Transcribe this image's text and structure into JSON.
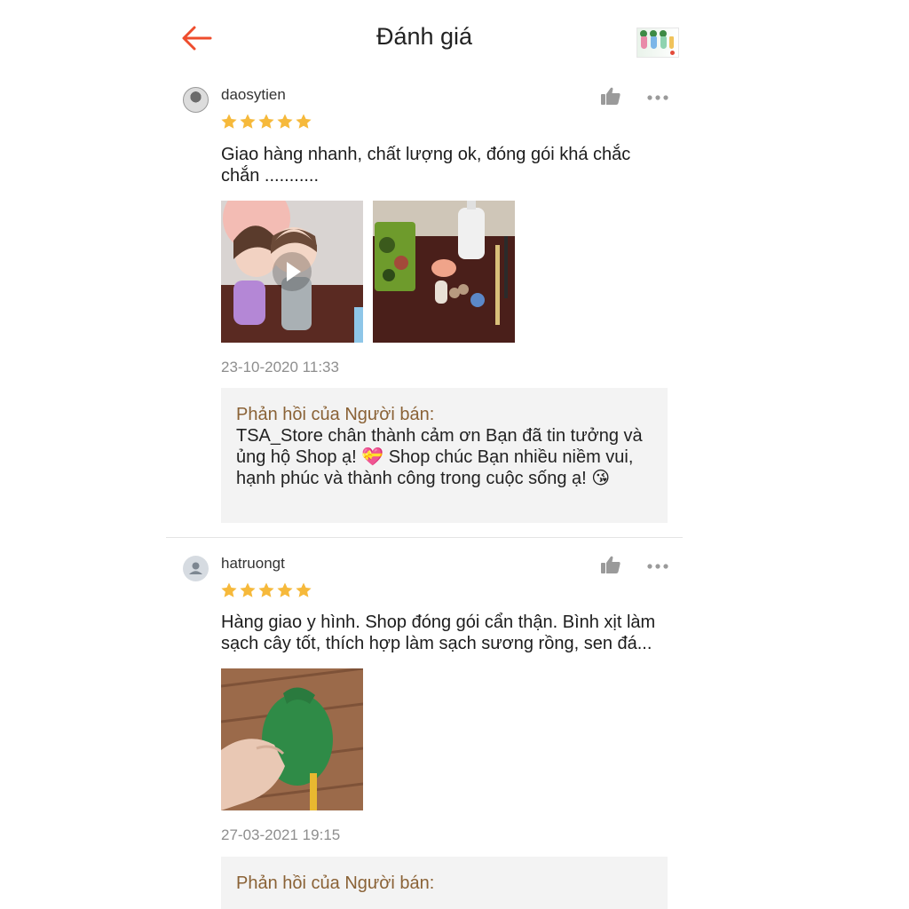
{
  "header": {
    "title": "Đánh giá",
    "back_icon": "arrow-left-icon",
    "accent_color": "#ee4d2d"
  },
  "colors": {
    "star": "#f6b93b",
    "reply_title": "#8a6236",
    "reply_bg": "#f3f3f3",
    "timestamp": "#8e8e8e"
  },
  "reviews": [
    {
      "username": "daosytien",
      "rating": 5,
      "comment": "Giao hàng nhanh, chất lượng ok, đóng gói khá chắc chắn ...........",
      "media": [
        {
          "type": "video",
          "icon": "play-icon"
        },
        {
          "type": "image"
        }
      ],
      "timestamp": "23-10-2020 11:33",
      "reply_title": "Phản hồi của Người bán:",
      "reply_text": "TSA_Store chân thành cảm ơn Bạn đã tin tưởng và ủng hộ Shop ạ! 💝 Shop chúc Bạn nhiều niềm vui, hạnh phúc và thành công trong cuộc sống ạ! 😘"
    },
    {
      "username": "hatruongt",
      "rating": 5,
      "comment": "Hàng giao y hình. Shop đóng gói cẩn thận. Bình xịt làm sạch cây tốt, thích hợp làm sạch sương rồng, sen đá...",
      "media": [
        {
          "type": "image"
        }
      ],
      "timestamp": "27-03-2021 19:15",
      "reply_title": "Phản hồi của Người bán:"
    }
  ]
}
